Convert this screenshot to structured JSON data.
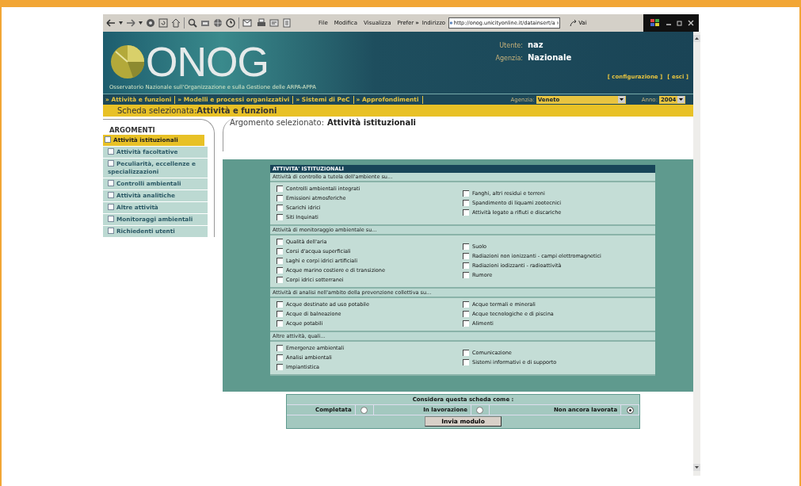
{
  "browser": {
    "menu": [
      "File",
      "Modifica",
      "Visualizza",
      "Prefer"
    ],
    "overflow": "»",
    "address_label": "Indirizzo",
    "address": "http://onog.unicityonline.it/datainsert/a",
    "go": "Vai"
  },
  "header": {
    "logo": "ONOG",
    "subtitle": "Osservatorio Nazionale sull'Organizzazione e sulla Gestione delle ARPA-APPA",
    "user_label": "Utente:",
    "user": "naz",
    "agency_label": "Agenzia:",
    "agency": "Nazionale",
    "links": [
      "[ configurazione ]",
      "[ esci ]"
    ]
  },
  "nav": {
    "items": [
      {
        "label": "» Attività e funzioni"
      },
      {
        "label": "» Modelli e processi organizzativi"
      },
      {
        "label": "» Sistemi di PeC"
      },
      {
        "label": "» Approfondimenti"
      }
    ],
    "agency_label": "Agenzia:",
    "agency": "Veneto",
    "year_label": "Anno:",
    "year": "2004"
  },
  "selected_sheet": {
    "label": "Scheda selezionata:",
    "value": "Attività e funzioni"
  },
  "sidebar": {
    "title": "ARGOMENTI",
    "items": [
      {
        "label": "Attività istituzionali",
        "selected": true
      },
      {
        "label": "Attività facoltative",
        "selected": false
      },
      {
        "label": "Peculiarità, eccellenze e specializzazioni",
        "selected": false
      },
      {
        "label": "Controlli ambientali",
        "selected": false
      },
      {
        "label": "Attività analitiche",
        "selected": false
      },
      {
        "label": "Altre attività",
        "selected": false
      },
      {
        "label": "Monitoraggi ambientali",
        "selected": false
      },
      {
        "label": "Richiedenti utenti",
        "selected": false
      }
    ]
  },
  "topic": {
    "label": "Argomento selezionato:",
    "value": "Attività istituzionali"
  },
  "form": {
    "title": "ATTIVITA' ISTITUZIONALI",
    "sections": [
      {
        "heading": "Attività di controllo a tutela dell'ambiente su...",
        "left": [
          {
            "label": "Controlli ambientali integrati",
            "checked": false
          },
          {
            "label": "Emissioni atmosferiche",
            "checked": false
          },
          {
            "label": "Scarichi idrici",
            "checked": false
          },
          {
            "label": "Siti Inquinati",
            "checked": false
          }
        ],
        "right": [
          {
            "label": "Fanghi, altri residui e terreni",
            "checked": false
          },
          {
            "label": "Spandimento di liquami zootecnici",
            "checked": false
          },
          {
            "label": "Attività legate a rifiuti e discariche",
            "checked": false
          }
        ]
      },
      {
        "heading": "Attività di monitoraggio ambientale su...",
        "left": [
          {
            "label": "Qualità dell'aria",
            "checked": false
          },
          {
            "label": "Corsi d'acqua superficiali",
            "checked": false
          },
          {
            "label": "Laghi e corpi idrici artificiali",
            "checked": false
          },
          {
            "label": "Acque marino costiere e di transizione",
            "checked": false
          },
          {
            "label": "Corpi idrici sotterranei",
            "checked": false
          }
        ],
        "right": [
          {
            "label": "Suolo",
            "checked": false
          },
          {
            "label": "Radiazioni non ionizzanti - campi elettromagnetici",
            "checked": false
          },
          {
            "label": "Radiazioni iodizzanti - radioattività",
            "checked": false
          },
          {
            "label": "Rumore",
            "checked": false
          }
        ]
      },
      {
        "heading": "Attività di analisi nell'ambito della prevenzione collettiva su...",
        "left": [
          {
            "label": "Acque destinate ad uso potabile",
            "checked": false
          },
          {
            "label": "Acque di balneazione",
            "checked": false
          },
          {
            "label": "Acque potabili",
            "checked": false
          }
        ],
        "right": [
          {
            "label": "Acque termali e minerali",
            "checked": false
          },
          {
            "label": "Acque tecnologiche e di piscina",
            "checked": false
          },
          {
            "label": "Alimenti",
            "checked": false
          }
        ]
      },
      {
        "heading": "Altre attività, quali...",
        "left": [
          {
            "label": "Emergenze ambientali",
            "checked": false
          },
          {
            "label": "Analisi ambientali",
            "checked": false
          },
          {
            "label": "Impiantistica",
            "checked": false
          }
        ],
        "right": [
          {
            "label": "Comunicazione",
            "checked": false
          },
          {
            "label": "Sistemi informativi e di supporto",
            "checked": false
          }
        ]
      }
    ]
  },
  "status": {
    "title": "Considera questa scheda come :",
    "options": [
      {
        "label": "Completata",
        "selected": false
      },
      {
        "label": "In lavorazione",
        "selected": false
      },
      {
        "label": "Non ancora lavorata",
        "selected": true
      }
    ],
    "submit": "Invia modulo"
  }
}
